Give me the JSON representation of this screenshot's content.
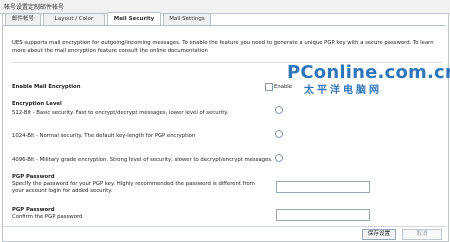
{
  "window": {
    "title": "帐号设置定制邮件帐号"
  },
  "tabs": [
    {
      "label": "邮件帐号"
    },
    {
      "label": "Layout / Color"
    },
    {
      "label": "Mail Security"
    },
    {
      "label": "Mail Settings"
    }
  ],
  "content": {
    "intro": "UES supports mail encryption for outgoing/incoming messages. To enable the feature you need to generate a unique PGP key with a secure password. To learn more about the mail encryption feature consult the online documentation",
    "enable_mail_encryption": {
      "label": "Enable Mail Encryption",
      "checkbox_text": "Enable",
      "checked": false
    },
    "encryption_level": {
      "heading": "Encryption Level",
      "options": [
        {
          "text": "512-Bit - Basic security. Fast to encrypt/decrypt messages, lower level of security.",
          "selected": false
        },
        {
          "text": "1024-Bit - Normal security. The default key-length for PGP encryption",
          "selected": false
        },
        {
          "text": "4096-Bit - Military grade encryption. Strong level of security, slower to decrypt/encrypt messages.",
          "selected": false
        }
      ]
    },
    "pgp_password": {
      "heading": "PGP Password",
      "help": "Specify the password for your PGP key. Highly recommended the password is different from your account login for added security.",
      "value": ""
    },
    "pgp_password_confirm": {
      "heading": "PGP Password",
      "help": "Confirm the PGP password",
      "value": ""
    }
  },
  "watermark": {
    "brand": "PConline.com.cn",
    "brand_cn": "太平洋电脑网"
  },
  "footer": {
    "save_label": "保存设置",
    "cancel_label": "取消"
  },
  "colors": {
    "accent_blue": "#0b5fb0",
    "border": "#b9c0c8"
  }
}
